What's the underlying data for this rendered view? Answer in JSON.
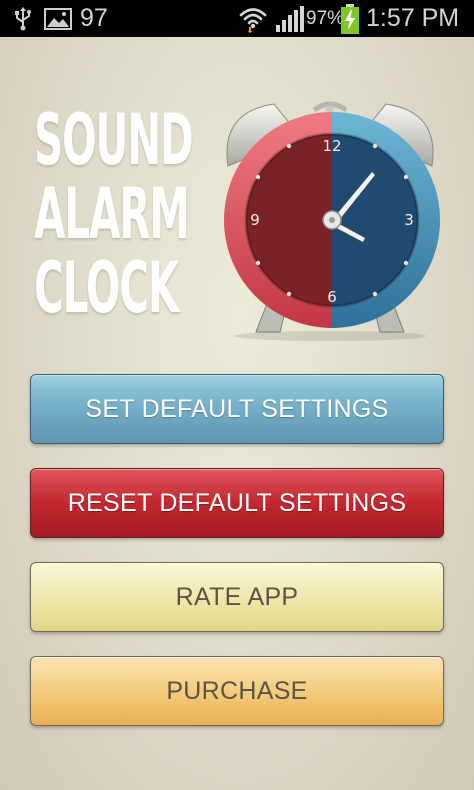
{
  "status_bar": {
    "notification_count": "97",
    "battery_percent": "97%",
    "time": "1:57 PM",
    "icons": [
      "usb-icon",
      "image-icon",
      "wifi-icon",
      "signal-icon",
      "battery-charging-icon"
    ]
  },
  "logo": {
    "lines": [
      "SOUND",
      "ALARM",
      "CLOCK"
    ],
    "clock_numbers": [
      "12",
      "3",
      "6",
      "9"
    ]
  },
  "buttons": {
    "set_default": "SET DEFAULT SETTINGS",
    "reset_default": "RESET DEFAULT SETTINGS",
    "rate_app": "RATE APP",
    "purchase": "PURCHASE"
  },
  "colors": {
    "set_button": "#78b2cb",
    "reset_button": "#c3282f",
    "rate_button": "#efe6aa",
    "purchase_button": "#f3c979",
    "clock_left": "#d94a55",
    "clock_right": "#3c7fa8"
  }
}
